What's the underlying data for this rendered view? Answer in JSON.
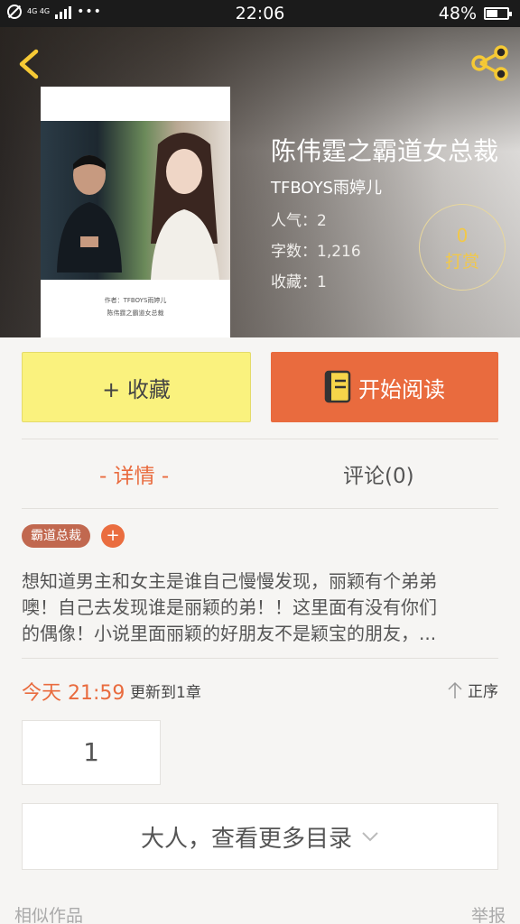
{
  "status_bar": {
    "time": "22:06",
    "battery": "48%",
    "network": "4G 4G",
    "dots": "•••"
  },
  "book": {
    "title": "陈伟霆之霸道女总裁",
    "author": "TFBOYS雨婷儿",
    "popularity": "人气：2",
    "word_count": "字数：1,216",
    "favorites": "收藏：1",
    "cover_author": "作者：TFBOYS雨婷儿",
    "cover_title": "陈伟霆之霸道女总裁"
  },
  "tip": {
    "count": "0",
    "label": "打赏"
  },
  "actions": {
    "favorite_label": "+ 收藏",
    "read_label": "开始阅读"
  },
  "tabs": [
    {
      "label": "- 详情 -"
    },
    {
      "label": "评论(0)"
    }
  ],
  "tag": {
    "label": "霸道总裁",
    "add": "+"
  },
  "description": [
    "想知道男主和女主是谁自己慢慢发现，丽颖有个弟弟",
    "噢！自己去发现谁是丽颖的弟！！这里面有没有你们",
    "的偶像！小说里面丽颖的好朋友不是颖宝的朋友，..."
  ],
  "update": {
    "time": "今天 21:59",
    "info": "更新到1章",
    "sort_label": "正序"
  },
  "chapters": [
    "1"
  ],
  "more_label": "大人，查看更多目录",
  "footer": {
    "similar": "相似作品",
    "report": "举报"
  },
  "colors": {
    "accent": "#e96b3e",
    "favorite_bg": "#faf27e",
    "tip_gold": "#f1c84a",
    "tag_bg": "#c1684f"
  },
  "icons": {
    "back": "chevron-left-icon",
    "share": "share-icon",
    "book": "book-icon",
    "sort": "arrow-up-icon",
    "more": "chevron-down-icon"
  }
}
